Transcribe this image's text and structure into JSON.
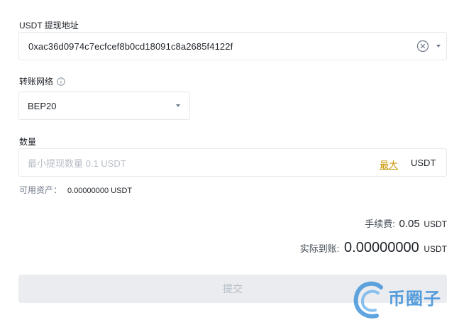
{
  "address": {
    "label": "USDT 提现地址",
    "value": "0xac36d0974c7ecfcef8b0cd18091c8a2685f4122f"
  },
  "network": {
    "label": "转账网络",
    "value": "BEP20"
  },
  "quantity": {
    "label": "数量",
    "placeholder": "最小提现数量 0.1 USDT",
    "max_label": "最大",
    "unit": "USDT"
  },
  "available": {
    "label": "可用资产：",
    "value": "0.00000000 USDT"
  },
  "fee": {
    "label": "手续费:",
    "value": "0.05",
    "unit": "USDT"
  },
  "receive": {
    "label": "实际到账:",
    "value": "0.00000000",
    "unit": "USDT"
  },
  "submit_label": "提交",
  "watermark": {
    "text": "币圈子"
  },
  "colors": {
    "accent": "#c99400",
    "disabled_button": "#eaecef",
    "watermark": "#3a8fd8"
  }
}
